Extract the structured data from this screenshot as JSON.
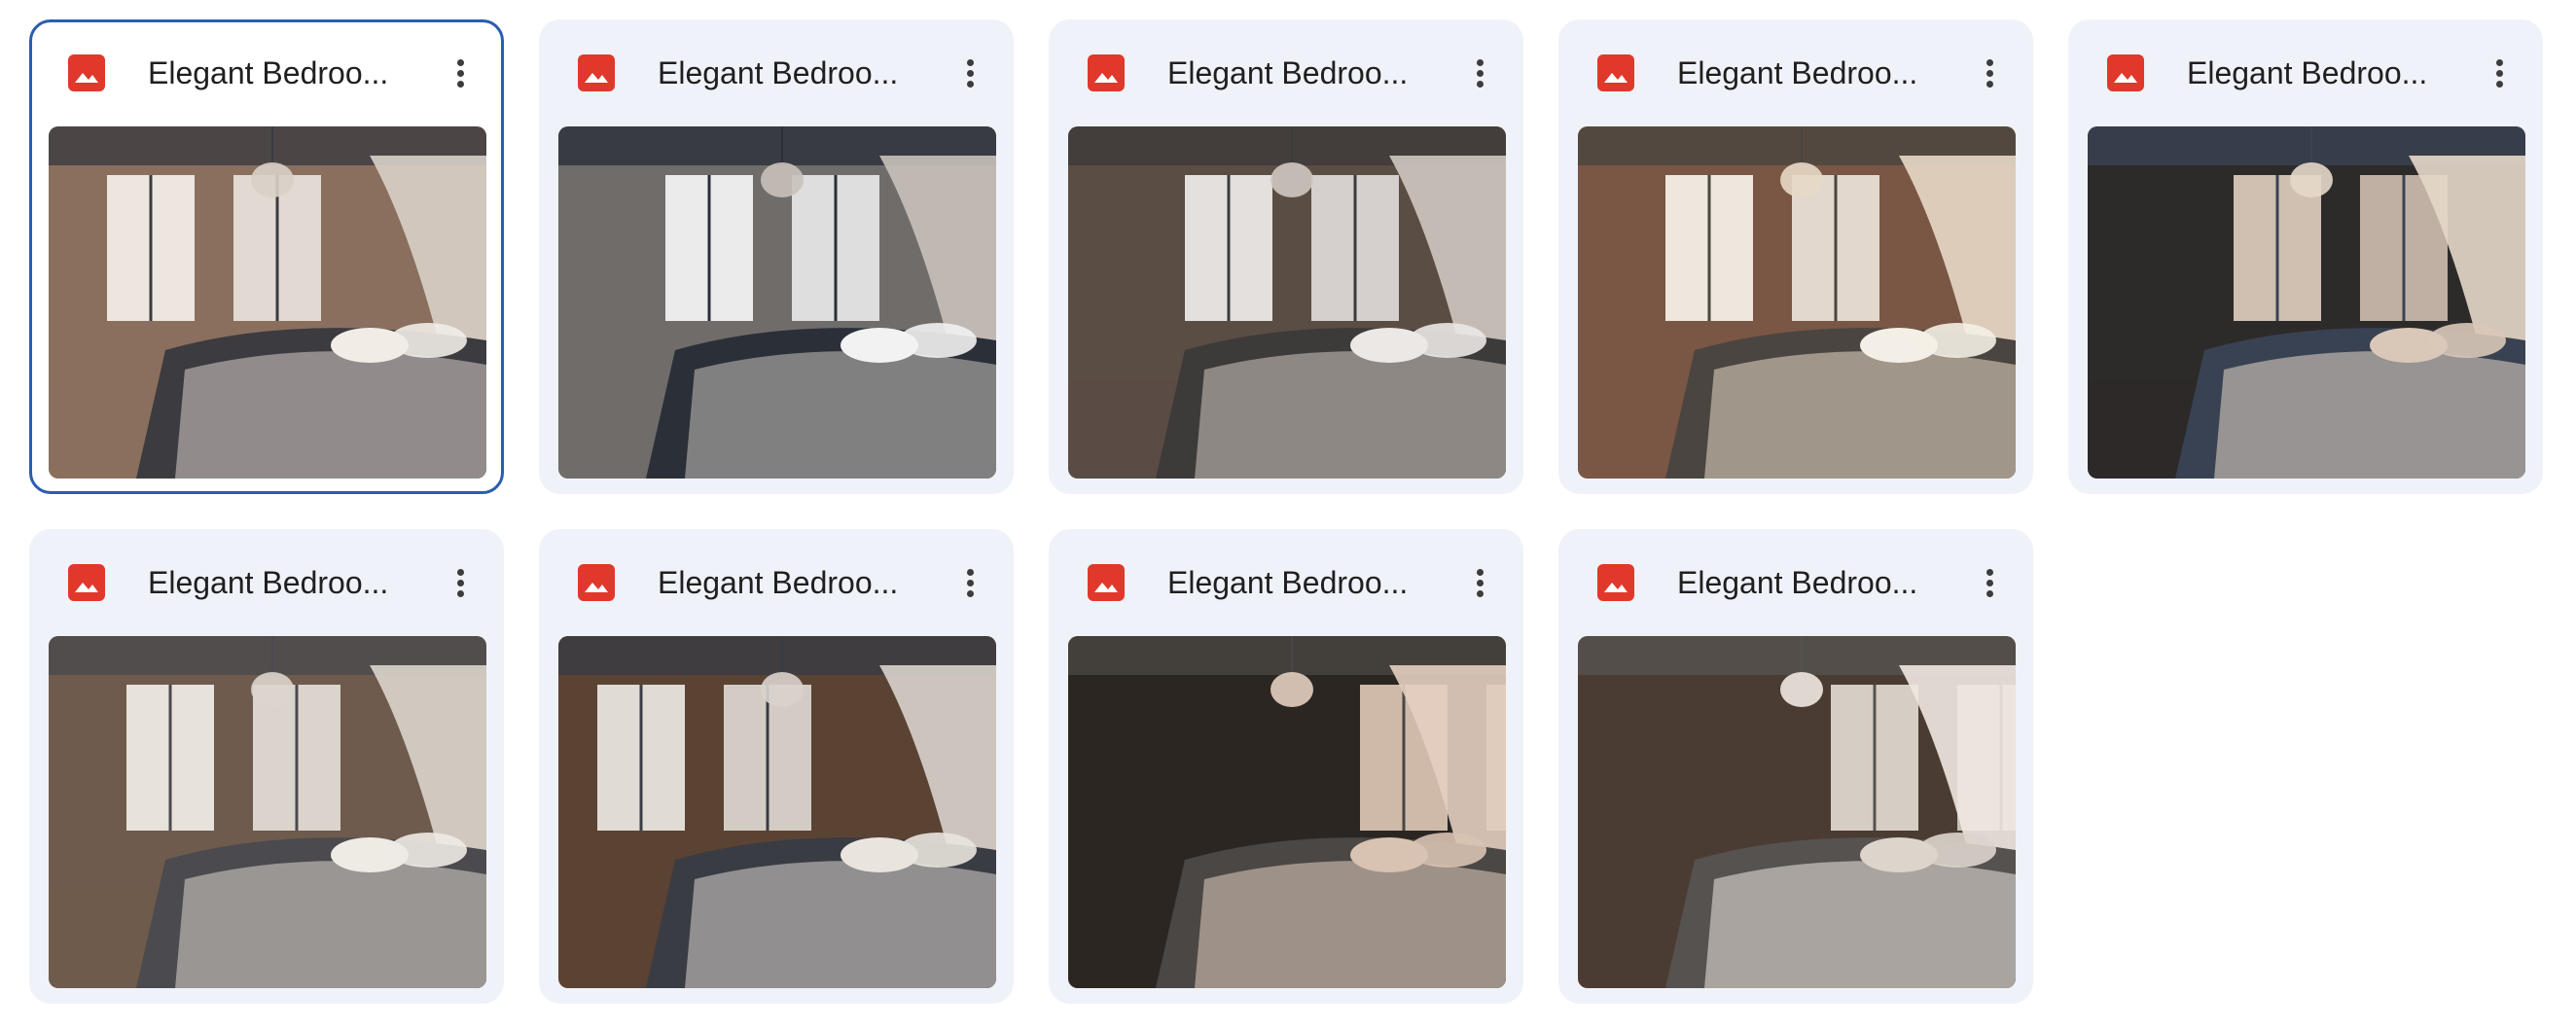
{
  "files": [
    {
      "name": "Elegant Bedroo...",
      "icon": "image-file-icon",
      "selected": true,
      "palette": [
        "#f1ece6",
        "#8a6f5e",
        "#3b3b40",
        "#d8d0c8"
      ]
    },
    {
      "name": "Elegant Bedroo...",
      "icon": "image-file-icon",
      "selected": false,
      "palette": [
        "#f2f2f2",
        "#6f6c6a",
        "#2b2f38",
        "#c9c2bb"
      ]
    },
    {
      "name": "Elegant Bedroo...",
      "icon": "image-file-icon",
      "selected": false,
      "palette": [
        "#ebe8e6",
        "#5a4d44",
        "#3d3a3a",
        "#cfc8c1"
      ]
    },
    {
      "name": "Elegant Bedroo...",
      "icon": "image-file-icon",
      "selected": false,
      "palette": [
        "#f4efe6",
        "#7a5644",
        "#4a4540",
        "#e8d9c6"
      ]
    },
    {
      "name": "Elegant Bedroo...",
      "icon": "image-file-icon",
      "selected": false,
      "palette": [
        "#d9c8b8",
        "#2d2a2a",
        "#394253",
        "#e6d8c9"
      ]
    },
    {
      "name": "Elegant Bedroo...",
      "icon": "image-file-icon",
      "selected": false,
      "palette": [
        "#eeeae4",
        "#6e5b4d",
        "#4b4a4e",
        "#dcd5cd"
      ]
    },
    {
      "name": "Elegant Bedroo...",
      "icon": "image-file-icon",
      "selected": false,
      "palette": [
        "#e9e4de",
        "#5b4334",
        "#3a3c44",
        "#d9d3cd"
      ]
    },
    {
      "name": "Elegant Bedroo...",
      "icon": "image-file-icon",
      "selected": false,
      "palette": [
        "#d8c2b2",
        "#2c2622",
        "#4a4744",
        "#e3cfc1"
      ]
    },
    {
      "name": "Elegant Bedroo...",
      "icon": "image-file-icon",
      "selected": false,
      "palette": [
        "#ddd5cc",
        "#4b3c33",
        "#55524f",
        "#efe8e1"
      ]
    }
  ],
  "colors": {
    "card_background": "#eff2f8",
    "selected_border": "#2a5db0",
    "file_icon": "#e0382b"
  }
}
